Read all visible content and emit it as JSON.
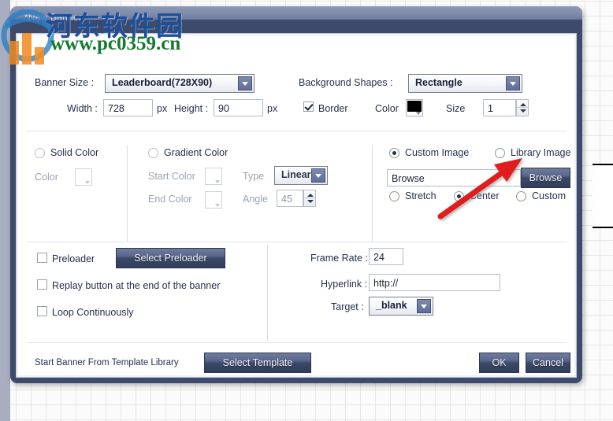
{
  "window": {
    "title": "*New Banner"
  },
  "watermark": {
    "site_name": "河东软件园",
    "url": "www.pc0359.cn",
    "logo_name": "pc0359-logo"
  },
  "size_section": {
    "banner_size_label": "Banner Size :",
    "banner_size_value": "Leaderboard(728X90)",
    "width_label": "Width :",
    "width_value": "728",
    "width_unit": "px",
    "height_label": "Height :",
    "height_value": "90",
    "height_unit": "px",
    "background_shapes_label": "Background Shapes :",
    "background_shapes_value": "Rectangle",
    "border_label": "Border",
    "border_checked": true,
    "color_label": "Color",
    "border_color_value": "#000000",
    "size_label": "Size",
    "size_value": "1"
  },
  "fill_section": {
    "solid_color": {
      "radio_label": "Solid Color",
      "selected": false,
      "enabled": false,
      "color_label": "Color",
      "color_value": "#ffffff"
    },
    "gradient_color": {
      "radio_label": "Gradient Color",
      "selected": false,
      "enabled": false,
      "start_color_label": "Start Color",
      "start_color_value": "#ffffff",
      "end_color_label": "End Color",
      "end_color_value": "#ffffff",
      "type_label": "Type",
      "type_value": "Linear",
      "angle_label": "Angle",
      "angle_value": "45"
    },
    "image": {
      "custom_image_label": "Custom Image",
      "custom_image_selected": true,
      "library_image_label": "Library Image",
      "library_image_selected": false,
      "path_value": "Browse",
      "browse_button_label": "Browse",
      "stretch_label": "Stretch",
      "stretch_selected": false,
      "center_label": "Center",
      "center_selected": true,
      "custom_label": "Custom",
      "custom_selected": false
    }
  },
  "playback_section": {
    "preloader_label": "Preloader",
    "preloader_checked": false,
    "select_preloader_button": "Select Preloader",
    "replay_label": "Replay button at the end of the banner",
    "replay_checked": false,
    "loop_label": "Loop Continuously",
    "loop_checked": false,
    "frame_rate_label": "Frame Rate :",
    "frame_rate_value": "24",
    "hyperlink_label": "Hyperlink :",
    "hyperlink_value": "http://",
    "target_label": "Target :",
    "target_value": "_blank"
  },
  "footer": {
    "template_text": "Start Banner From Template Library",
    "select_template_button": "Select Template",
    "ok_button": "OK",
    "cancel_button": "Cancel"
  },
  "annotation": {
    "arrow_name": "red-pointer-arrow",
    "arrow_color": "#e01b1b"
  },
  "colors": {
    "titlebar_dark": "#3e4a6b",
    "button_gradient_top": "#6f7c9d",
    "button_gradient_bottom": "#323c5a",
    "accent_blue": "#5f6e99"
  }
}
